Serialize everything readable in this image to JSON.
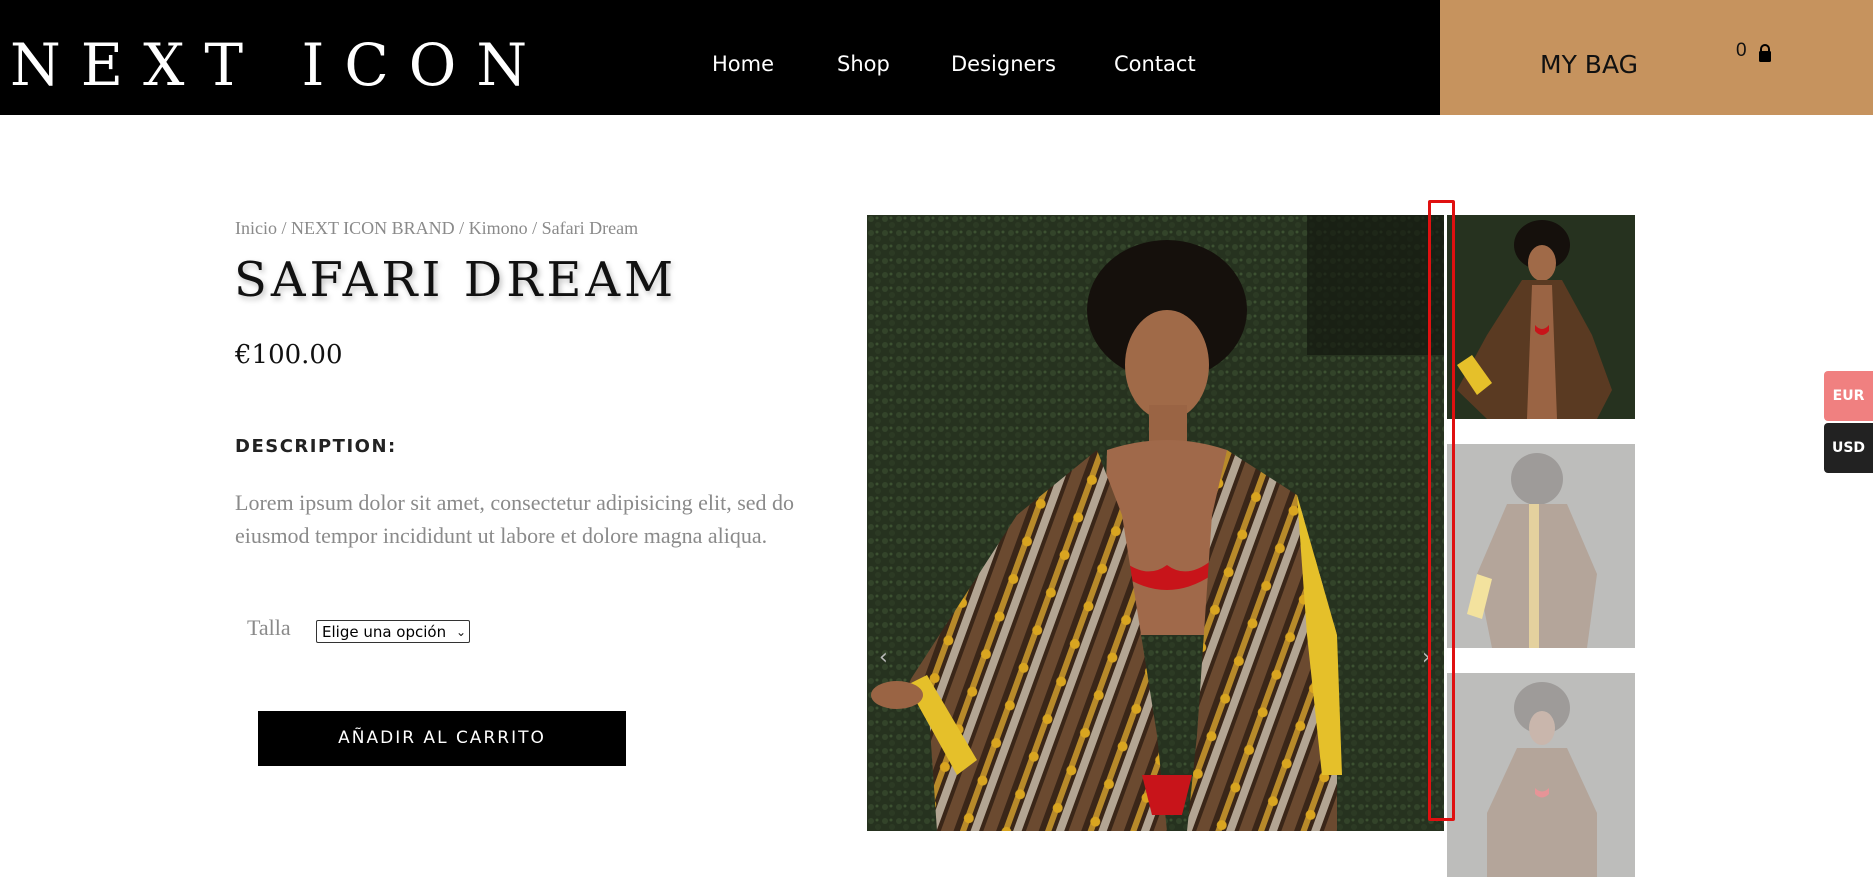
{
  "header": {
    "logo": "NEXT ICON",
    "nav": [
      {
        "label": "Home"
      },
      {
        "label": "Shop"
      },
      {
        "label": "Designers"
      },
      {
        "label": "Contact"
      }
    ],
    "bag_label": "MY BAG",
    "bag_count": "0",
    "colors": {
      "bar": "#000000",
      "bag": "#c6935e"
    }
  },
  "product": {
    "breadcrumb": "Inicio / NEXT ICON BRAND / Kimono / Safari Dream",
    "title": "SAFARI DREAM",
    "price": "€100.00",
    "description_heading": "DESCRIPTION:",
    "description": "Lorem ipsum dolor sit amet, consectetur adipisicing elit, sed do eiusmod tempor incididunt ut labore et dolore magna aliqua.",
    "size_label": "Talla",
    "size_select_value": "Elige una opción",
    "add_to_cart_label": "AÑADIR AL CARRITO"
  },
  "gallery": {
    "prev_icon": "‹",
    "next_icon": "›",
    "thumb_count": 3
  },
  "currency": {
    "options": [
      {
        "label": "EUR",
        "color": "#f08080"
      },
      {
        "label": "USD",
        "color": "#222222"
      }
    ]
  }
}
